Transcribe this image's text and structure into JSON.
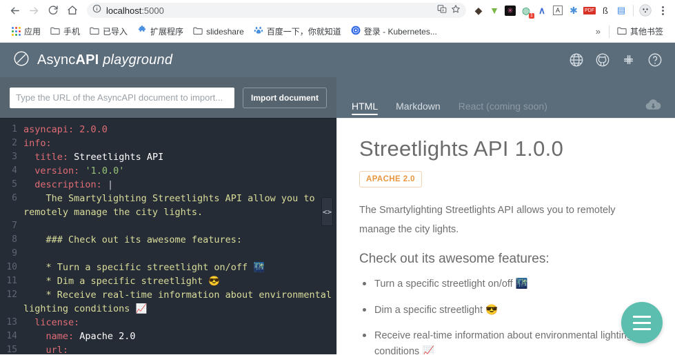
{
  "browser": {
    "nav": {
      "back": "back-arrow",
      "forward": "forward-arrow",
      "reload": "reload-icon",
      "home": "home-icon"
    },
    "omnibox": {
      "info_icon": "info-circle-icon",
      "host": "localhost",
      "port": ":5000",
      "full_url": "localhost:5000",
      "translate_icon": "translate-icon",
      "star_icon": "bookmark-star-icon"
    },
    "extensions": [
      {
        "name": "zotero-extension",
        "glyph": "◆",
        "color": "#3b2f2f"
      },
      {
        "name": "download-helper-extension",
        "glyph": "▼",
        "color": "#6ab04c"
      },
      {
        "name": "dark-reader-extension",
        "glyph": "✳",
        "color": "#111111"
      },
      {
        "name": "session-manager-extension",
        "glyph": "◍",
        "color": "#2e9e6b",
        "badge": "1"
      },
      {
        "name": "adguard-extension",
        "glyph": "∧",
        "color": "#3f6fd8"
      },
      {
        "name": "grammar-extension",
        "glyph": "A",
        "color": "#444444"
      },
      {
        "name": "asterisk-extension",
        "glyph": "✱",
        "color": "#4a90d9"
      },
      {
        "name": "pdf-extension",
        "glyph": "▤",
        "color": "#d93025"
      },
      {
        "name": "evernote-extension",
        "glyph": "ß",
        "color": "#333333"
      },
      {
        "name": "bluetooth-extension",
        "glyph": "▤",
        "color": "#3f8ae0"
      }
    ],
    "profile_icon": "profile-avatar-icon",
    "menu_icon": "chrome-menu-icon",
    "bookmarks": [
      {
        "name": "apps",
        "label": "应用",
        "icon": "apps-grid-icon"
      },
      {
        "name": "phone",
        "label": "手机",
        "icon": "folder-icon"
      },
      {
        "name": "imported",
        "label": "已导入",
        "icon": "folder-icon"
      },
      {
        "name": "extensions",
        "label": "扩展程序",
        "icon": "puzzle-icon"
      },
      {
        "name": "slideshare",
        "label": "slideshare",
        "icon": "folder-icon"
      },
      {
        "name": "baidu",
        "label": "百度一下，你就知道",
        "icon": "baidu-icon"
      },
      {
        "name": "kubernetes",
        "label": "登录 - Kubernetes...",
        "icon": "kubernetes-icon"
      }
    ],
    "overflow_label": "»",
    "other_bookmarks": {
      "label": "其他书签",
      "icon": "folder-icon"
    }
  },
  "app": {
    "header": {
      "logo_icon": "asyncapi-logo-icon",
      "brand_main": "AsyncAPI",
      "brand_prefix": "Async",
      "brand_bold": "API",
      "brand_sub": "playground",
      "icons": [
        {
          "name": "globe-icon",
          "title": "website"
        },
        {
          "name": "github-icon",
          "title": "github"
        },
        {
          "name": "slack-icon",
          "title": "slack"
        },
        {
          "name": "help-icon",
          "title": "help"
        }
      ]
    },
    "toolbar": {
      "url_placeholder": "Type the URL of the AsyncAPI document to import...",
      "url_value": "",
      "import_label": "Import document",
      "download_icon": "cloud-download-icon"
    },
    "tabs": [
      {
        "label": "HTML",
        "state": "active"
      },
      {
        "label": "Markdown",
        "state": "default"
      },
      {
        "label": "React (coming soon)",
        "state": "disabled"
      }
    ],
    "splitter": {
      "glyph": "<>",
      "name": "splitter-handle"
    }
  },
  "editor": {
    "lines": [
      {
        "n": "1",
        "segments": [
          {
            "t": "asyncapi:",
            "c": "k"
          },
          {
            "t": " ",
            "c": "v"
          },
          {
            "t": "2.0.0",
            "c": "num"
          }
        ]
      },
      {
        "n": "2",
        "segments": [
          {
            "t": "info:",
            "c": "k"
          }
        ]
      },
      {
        "n": "3",
        "segments": [
          {
            "t": "  ",
            "c": "v"
          },
          {
            "t": "title:",
            "c": "k"
          },
          {
            "t": " Streetlights API",
            "c": "v"
          }
        ]
      },
      {
        "n": "4",
        "segments": [
          {
            "t": "  ",
            "c": "v"
          },
          {
            "t": "version:",
            "c": "k"
          },
          {
            "t": " ",
            "c": "v"
          },
          {
            "t": "'1.0.0'",
            "c": "str"
          }
        ]
      },
      {
        "n": "5",
        "segments": [
          {
            "t": "  ",
            "c": "v"
          },
          {
            "t": "description:",
            "c": "k"
          },
          {
            "t": " ",
            "c": "v"
          },
          {
            "t": "|",
            "c": "pipe"
          }
        ]
      },
      {
        "n": "6",
        "segments": [
          {
            "t": "    The Smartylighting Streetlights API allow you to remotely manage the city lights.",
            "c": "blk"
          }
        ]
      },
      {
        "n": "7",
        "segments": [
          {
            "t": "",
            "c": "blk"
          }
        ]
      },
      {
        "n": "8",
        "segments": [
          {
            "t": "    ### Check out its awesome features:",
            "c": "blk"
          }
        ]
      },
      {
        "n": "9",
        "segments": [
          {
            "t": "",
            "c": "blk"
          }
        ]
      },
      {
        "n": "10",
        "segments": [
          {
            "t": "    * Turn a specific streetlight on/off 🌃",
            "c": "blk"
          }
        ]
      },
      {
        "n": "11",
        "segments": [
          {
            "t": "    * Dim a specific streetlight 😎",
            "c": "blk"
          }
        ]
      },
      {
        "n": "12",
        "segments": [
          {
            "t": "    * Receive real-time information about environmental lighting conditions 📈",
            "c": "blk"
          }
        ]
      },
      {
        "n": "13",
        "segments": [
          {
            "t": "  ",
            "c": "v"
          },
          {
            "t": "license:",
            "c": "k"
          }
        ]
      },
      {
        "n": "14",
        "segments": [
          {
            "t": "    ",
            "c": "v"
          },
          {
            "t": "name:",
            "c": "k"
          },
          {
            "t": " Apache 2.0",
            "c": "v"
          }
        ]
      },
      {
        "n": "15",
        "segments": [
          {
            "t": "    ",
            "c": "v"
          },
          {
            "t": "url:",
            "c": "k"
          }
        ]
      }
    ]
  },
  "preview": {
    "title": "Streetlights API 1.0.0",
    "license_badge": "APACHE 2.0",
    "description": "The Smartylighting Streetlights API allows you to remotely manage the city lights.",
    "features_heading": "Check out its awesome features:",
    "features": [
      "Turn a specific streetlight on/off 🌃",
      "Dim a specific streetlight 😎",
      "Receive real-time information about environmental lighting conditions 📈"
    ],
    "fab": {
      "name": "menu-fab",
      "icon": "hamburger-menu-icon",
      "color": "#5cbeae"
    }
  },
  "colors": {
    "header_bg": "#5b6c7b",
    "subbar_bg": "#55646f",
    "editor_bg": "#262c36",
    "accent_teal": "#5cbeae",
    "badge_orange": "#e8953f"
  }
}
